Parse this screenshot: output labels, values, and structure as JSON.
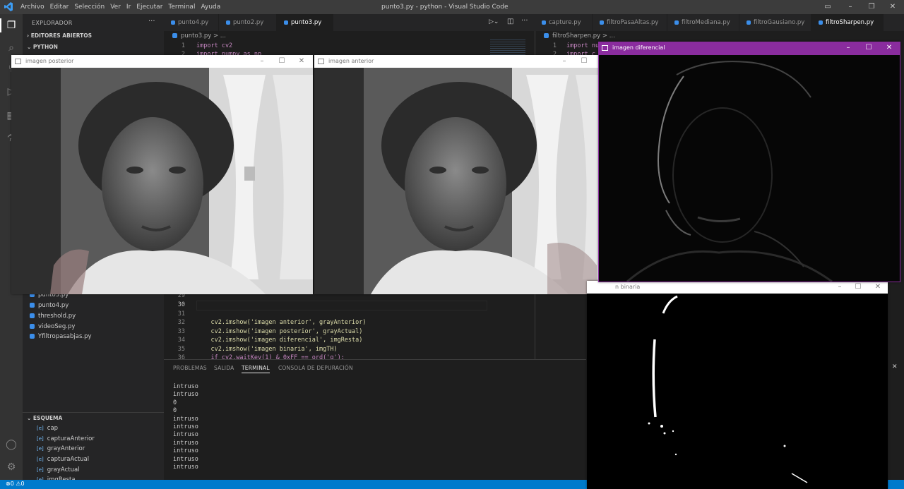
{
  "window": {
    "title": "punto3.py - python - Visual Studio Code",
    "menu": [
      "Archivo",
      "Editar",
      "Selección",
      "Ver",
      "Ir",
      "Ejecutar",
      "Terminal",
      "Ayuda"
    ]
  },
  "explorer": {
    "title": "EXPLORADOR",
    "open_editors": "EDITORES ABIERTOS",
    "folder": "PYTHON",
    "files": [
      "punto3.py",
      "punto4.py",
      "threshold.py",
      "videoSeg.py",
      "Yfiltropasabjas.py"
    ],
    "outline_title": "ESQUEMA",
    "outline": [
      "cap",
      "capturaAnterior",
      "grayAnterior",
      "capturaActual",
      "grayActual",
      "imgResta"
    ]
  },
  "editor1": {
    "tabs": [
      "punto4.py",
      "punto2.py",
      "punto3.py"
    ],
    "active_tab": "punto3.py",
    "breadcrumb": "punto3.py > ...",
    "top_lines": [
      {
        "n": "1",
        "code": "import cv2"
      },
      {
        "n": "2",
        "code": "import numpy as np"
      }
    ],
    "lines": [
      {
        "n": "29",
        "code": ""
      },
      {
        "n": "30",
        "code": ""
      },
      {
        "n": "31",
        "code": ""
      },
      {
        "n": "32",
        "code": "    cv2.imshow('imagen anterior', grayAnterior)"
      },
      {
        "n": "33",
        "code": "    cv2.imshow('imagen posterior', grayActual)"
      },
      {
        "n": "34",
        "code": "    cv2.imshow('imagen diferencial', imgResta)"
      },
      {
        "n": "35",
        "code": "    cv2.imshow('imagen binaria', imgTH)"
      },
      {
        "n": "36",
        "code": "    if cv2.waitKey(1) & 0xFF == ord('q'):"
      }
    ]
  },
  "editor2": {
    "tabs": [
      "capture.py",
      "filtroPasaAltas.py",
      "filtroMediana.py",
      "filtroGausiano.py",
      "filtroSharpen.py"
    ],
    "active_tab": "filtroSharpen.py",
    "breadcrumb": "filtroSharpen.py > ...",
    "lines": [
      {
        "n": "1",
        "code": "import nu"
      },
      {
        "n": "2",
        "code": "import c"
      }
    ]
  },
  "panel": {
    "tabs": [
      "PROBLEMAS",
      "SALIDA",
      "TERMINAL",
      "CONSOLA DE DEPURACIÓN"
    ],
    "active_tab": "TERMINAL",
    "output": [
      "intruso",
      "intruso",
      "0",
      "0",
      "intruso",
      "intruso",
      "intruso",
      "intruso",
      "intruso",
      "intruso",
      "intruso"
    ]
  },
  "status": {
    "errors": "0",
    "warnings": "0"
  },
  "cv_windows": {
    "posterior": "imagen posterior",
    "anterior": "imagen anterior",
    "diferencial": "imagen diferencial",
    "binaria": "n binaria"
  },
  "colors": {
    "accent": "#007acc",
    "cv_active_title": "#8a2c9e"
  }
}
